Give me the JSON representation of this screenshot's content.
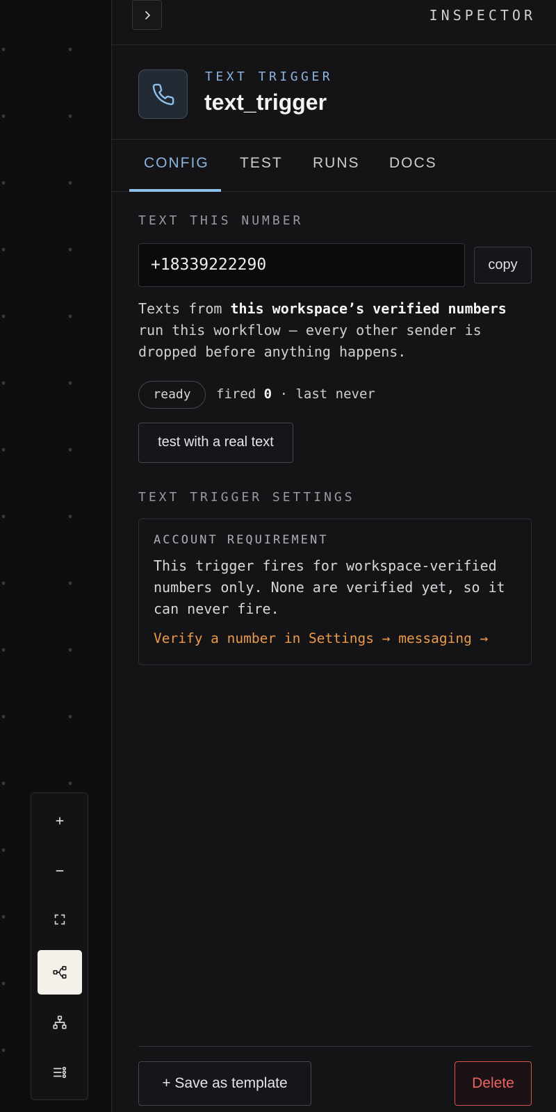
{
  "inspector": {
    "title": "INSPECTOR",
    "collapse_icon": "chevron-right-icon"
  },
  "node": {
    "kind": "TEXT TRIGGER",
    "name": "text_trigger",
    "icon": "phone-icon",
    "accent": "#8ec1ea"
  },
  "tabs": [
    {
      "label": "CONFIG",
      "active": true
    },
    {
      "label": "TEST",
      "active": false
    },
    {
      "label": "RUNS",
      "active": false
    },
    {
      "label": "DOCS",
      "active": false
    }
  ],
  "config": {
    "section_label": "TEXT THIS NUMBER",
    "number": "+18339222290",
    "copy_label": "copy",
    "desc_prefix": "Texts from ",
    "desc_bold": "this workspace’s verified numbers",
    "desc_suffix": " run this workflow — every other sender is dropped before anything happens.",
    "status_badge": "ready",
    "fired_label": "fired",
    "fired_count": "0",
    "last_label": "· last never",
    "test_button": "test with a real text"
  },
  "settings": {
    "section_label": "TEXT TRIGGER SETTINGS",
    "requirement_title": "ACCOUNT REQUIREMENT",
    "requirement_body": "This trigger fires for workspace-verified numbers only. None are verified yet, so it can never fire.",
    "requirement_link": "Verify a number in Settings → messaging →",
    "link_color": "#eb9a4a"
  },
  "footer": {
    "save_template": "+ Save as template",
    "delete": "Delete",
    "delete_color": "#ef6461"
  },
  "canvas_controls": [
    {
      "icon": "zoom-in-icon",
      "active": false
    },
    {
      "icon": "zoom-out-icon",
      "active": false
    },
    {
      "icon": "fit-view-icon",
      "active": false
    },
    {
      "icon": "flow-layout-icon",
      "active": true
    },
    {
      "icon": "tree-layout-icon",
      "active": false
    },
    {
      "icon": "list-settings-icon",
      "active": false
    }
  ]
}
